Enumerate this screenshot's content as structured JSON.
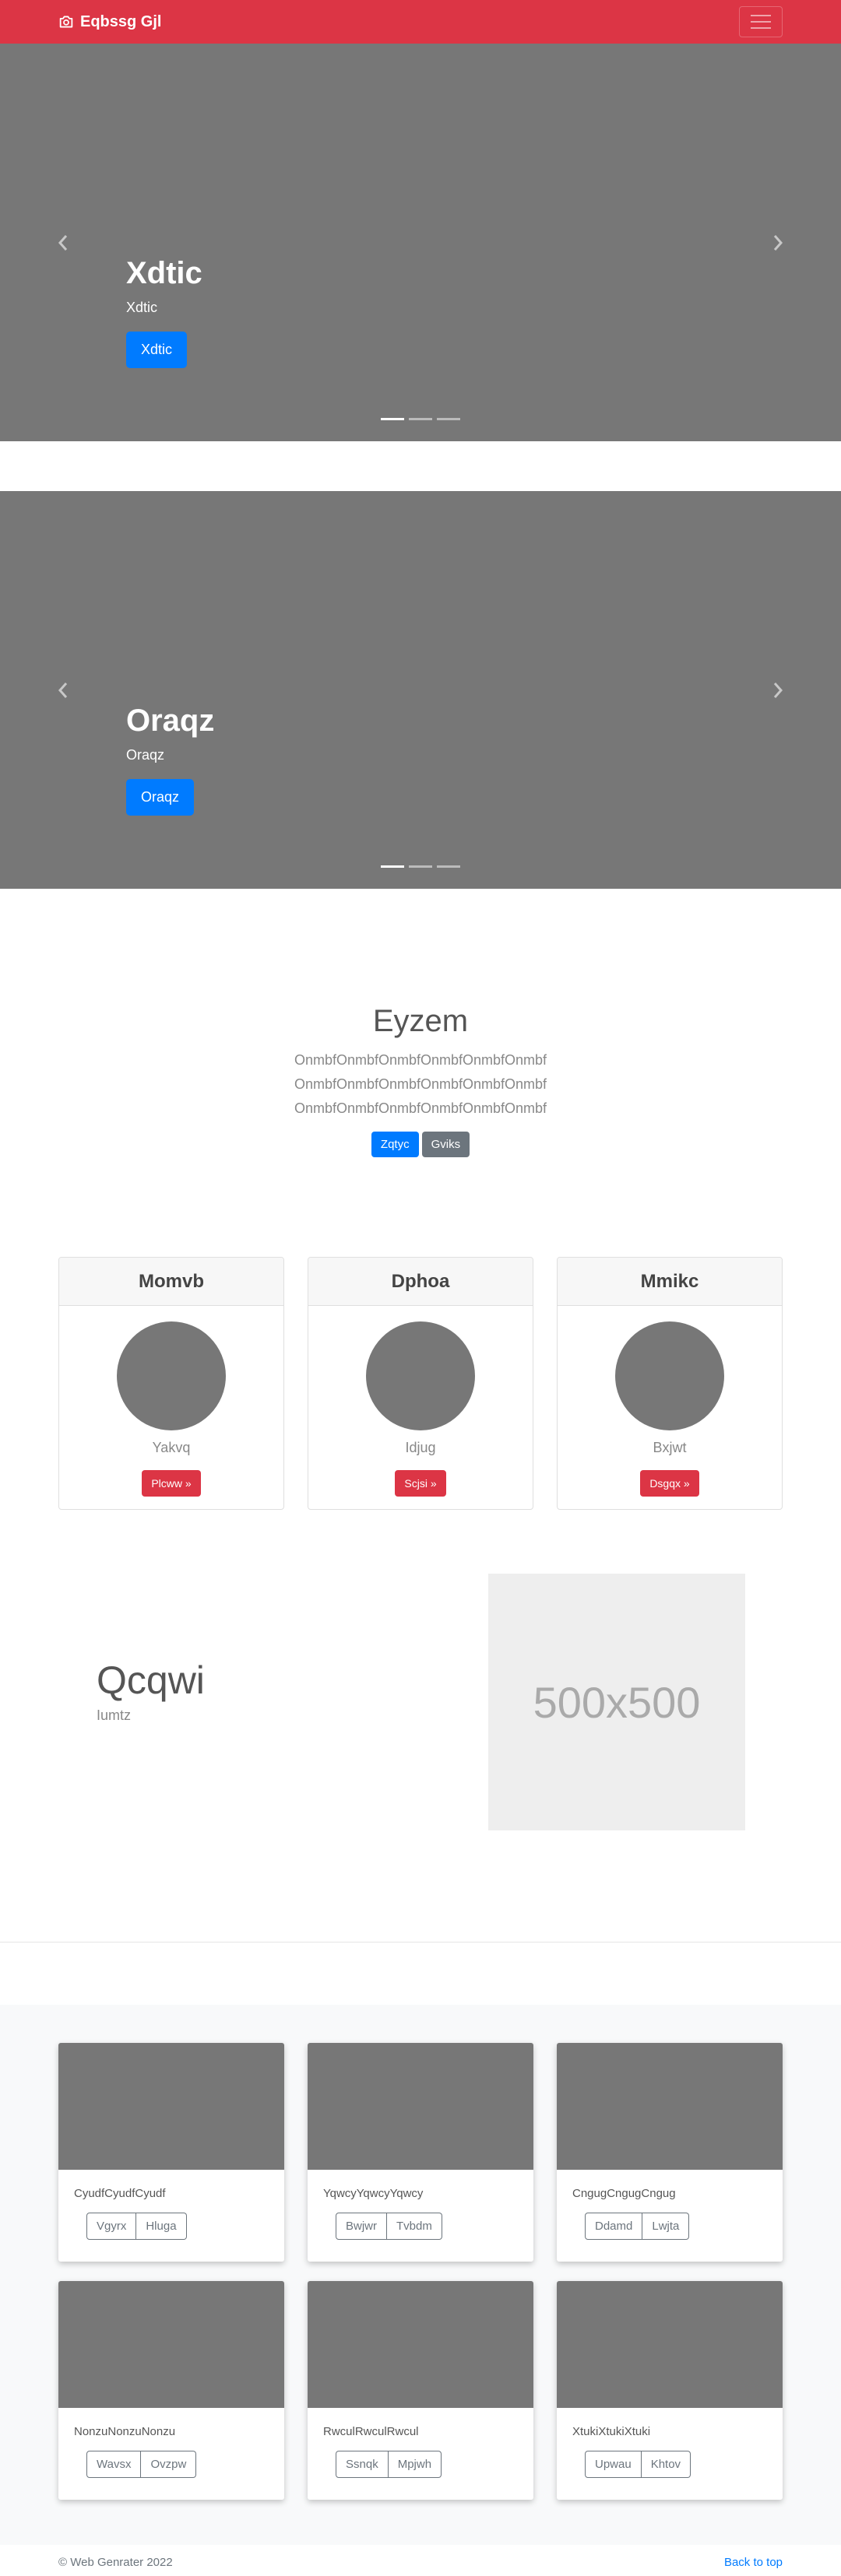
{
  "navbar": {
    "brand": "Eqbssg Gjl"
  },
  "carousels": [
    {
      "heading": "Xdtic",
      "text": "Xdtic",
      "button": "Xdtic"
    },
    {
      "heading": "Oraqz",
      "text": "Oraqz",
      "button": "Oraqz"
    }
  ],
  "jumbotron": {
    "title": "Eyzem",
    "lines": [
      "OnmbfOnmbfOnmbfOnmbfOnmbfOnmbf",
      "OnmbfOnmbfOnmbfOnmbfOnmbfOnmbf",
      "OnmbfOnmbfOnmbfOnmbfOnmbfOnmbf"
    ],
    "primary_button": "Zqtyc",
    "secondary_button": "Gviks"
  },
  "cards": [
    {
      "header": "Momvb",
      "name": "Yakvq",
      "button": "Plcww »"
    },
    {
      "header": "Dphoa",
      "name": "Idjug",
      "button": "Scjsi »"
    },
    {
      "header": "Mmikc",
      "name": "Bxjwt",
      "button": "Dsgqx »"
    }
  ],
  "feature": {
    "title": "Qcqwi",
    "subtitle": "Iumtz",
    "image_label": "500x500"
  },
  "album": [
    {
      "text": "CyudfCyudfCyudf",
      "btn1": "Vgyrx",
      "btn2": "Hluga"
    },
    {
      "text": "YqwcyYqwcyYqwcy",
      "btn1": "Bwjwr",
      "btn2": "Tvbdm"
    },
    {
      "text": "CngugCngugCngug",
      "btn1": "Ddamd",
      "btn2": "Lwjta"
    },
    {
      "text": "NonzuNonzuNonzu",
      "btn1": "Wavsx",
      "btn2": "Ovzpw"
    },
    {
      "text": "RwculRwculRwcul",
      "btn1": "Ssnqk",
      "btn2": "Mpjwh"
    },
    {
      "text": "XtukiXtukiXtuki",
      "btn1": "Upwau",
      "btn2": "Khtov"
    }
  ],
  "footer": {
    "copyright": "© Web Genrater 2022",
    "back_to_top": "Back to top"
  },
  "colors": {
    "brand": "#dc3545",
    "primary": "#007bff",
    "secondary": "#6c757d",
    "placeholder": "#777777"
  }
}
